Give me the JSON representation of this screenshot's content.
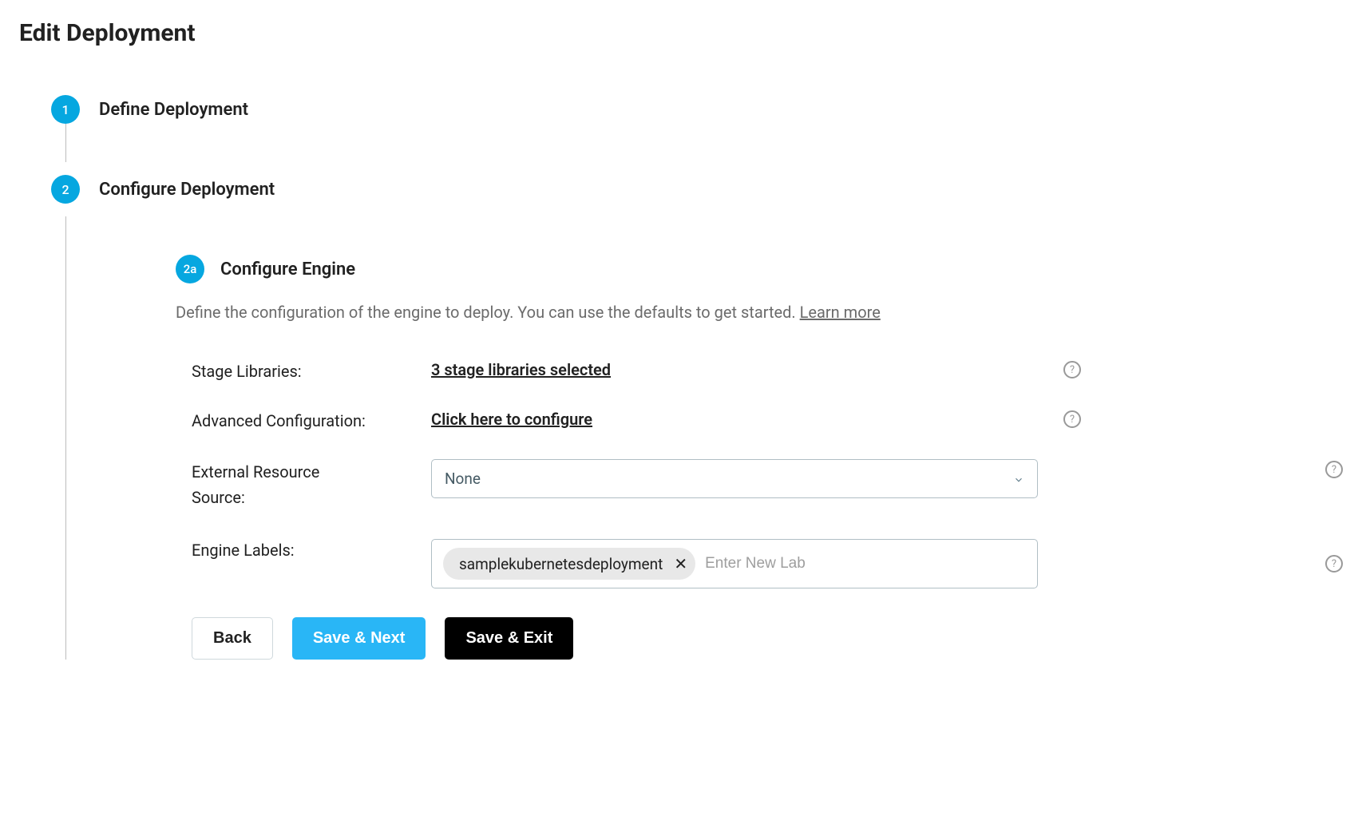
{
  "page": {
    "title": "Edit Deployment"
  },
  "steps": [
    {
      "number": "1",
      "label": "Define Deployment"
    },
    {
      "number": "2",
      "label": "Configure Deployment"
    }
  ],
  "substep": {
    "number": "2a",
    "label": "Configure Engine",
    "description_prefix": "Define the configuration of the engine to deploy. You can use the defaults to get started. ",
    "learn_more": "Learn more"
  },
  "form": {
    "stage_libraries": {
      "label": "Stage Libraries:",
      "value": "3 stage libraries selected"
    },
    "advanced_config": {
      "label": "Advanced Configuration:",
      "value": "Click here to configure"
    },
    "external_resource": {
      "label_line1": "External Resource",
      "label_line2": "Source:",
      "value": "None"
    },
    "engine_labels": {
      "label": "Engine Labels:",
      "tag": "samplekubernetesdeployment",
      "placeholder": "Enter New Lab"
    }
  },
  "buttons": {
    "back": "Back",
    "save_next": "Save & Next",
    "save_exit": "Save & Exit"
  }
}
